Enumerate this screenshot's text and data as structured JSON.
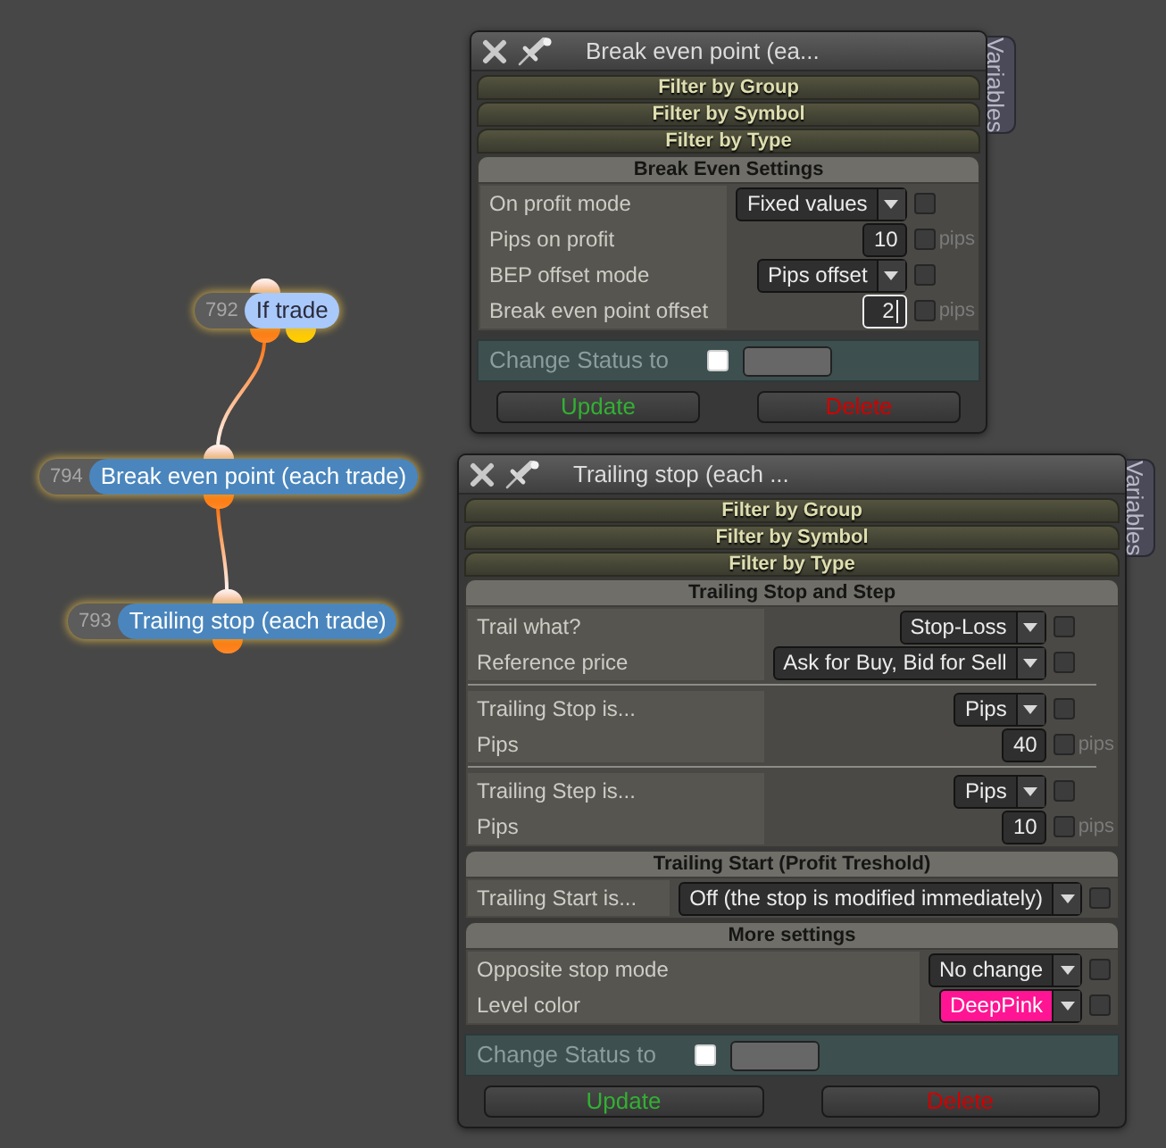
{
  "canvas": {
    "nodes": [
      {
        "number": "792",
        "title": "If trade",
        "kind": "condition"
      },
      {
        "number": "794",
        "title": "Break even point (each trade)",
        "kind": "action"
      },
      {
        "number": "793",
        "title": "Trailing stop (each trade)",
        "kind": "action"
      }
    ]
  },
  "windows": [
    {
      "title": "Break even point (ea...",
      "side_tab": "Variables",
      "filters": [
        "Filter by Group",
        "Filter by Symbol",
        "Filter by Type"
      ],
      "sections": [
        {
          "title": "Break Even Settings",
          "groups": [
            {
              "rows": [
                {
                  "kind": "dropdown",
                  "label": "On profit mode",
                  "value": "Fixed values",
                  "checked": false
                },
                {
                  "kind": "number",
                  "label": "Pips on profit",
                  "value": "10",
                  "unit": "pips",
                  "checked": false,
                  "focused": false
                },
                {
                  "kind": "dropdown",
                  "label": "BEP offset mode",
                  "value": "Pips offset",
                  "checked": false
                },
                {
                  "kind": "number",
                  "label": "Break even point offset",
                  "value": "2",
                  "unit": "pips",
                  "checked": false,
                  "focused": true
                }
              ]
            }
          ]
        }
      ],
      "change_status": {
        "label": "Change Status to",
        "checked": false
      },
      "buttons": [
        {
          "label": "Update",
          "kind": "update"
        },
        {
          "label": "Delete",
          "kind": "delete"
        }
      ]
    },
    {
      "title": "Trailing stop (each ...",
      "side_tab": "Variables",
      "filters": [
        "Filter by Group",
        "Filter by Symbol",
        "Filter by Type"
      ],
      "sections": [
        {
          "title": "Trailing Stop and Step",
          "groups": [
            {
              "rows": [
                {
                  "kind": "dropdown",
                  "label": "Trail what?",
                  "value": "Stop-Loss",
                  "checked": false
                },
                {
                  "kind": "dropdown",
                  "label": "Reference price",
                  "value": "Ask for Buy, Bid for Sell",
                  "checked": false
                }
              ]
            },
            {
              "rows": [
                {
                  "kind": "dropdown",
                  "label": "Trailing Stop is...",
                  "value": "Pips",
                  "checked": false
                },
                {
                  "kind": "number",
                  "label": "Pips",
                  "value": "40",
                  "unit": "pips",
                  "checked": false,
                  "focused": false
                }
              ]
            },
            {
              "rows": [
                {
                  "kind": "dropdown",
                  "label": "Trailing Step is...",
                  "value": "Pips",
                  "checked": false
                },
                {
                  "kind": "number",
                  "label": "Pips",
                  "value": "10",
                  "unit": "pips",
                  "checked": false,
                  "focused": false
                }
              ]
            }
          ]
        },
        {
          "title": "Trailing Start (Profit Treshold)",
          "groups": [
            {
              "rows": [
                {
                  "kind": "dropdown",
                  "label": "Trailing Start is...",
                  "value": "Off (the stop is modified immediately)",
                  "checked": false
                }
              ]
            }
          ]
        },
        {
          "title": "More settings",
          "groups": [
            {
              "rows": [
                {
                  "kind": "dropdown",
                  "label": "Opposite stop mode",
                  "value": "No change",
                  "checked": false
                },
                {
                  "kind": "dropdown",
                  "label": "Level color",
                  "value": "DeepPink",
                  "color": "#ff1493",
                  "checked": false
                }
              ]
            }
          ]
        }
      ],
      "change_status": {
        "label": "Change Status to",
        "checked": false
      },
      "buttons": [
        {
          "label": "Update",
          "kind": "update"
        },
        {
          "label": "Delete",
          "kind": "delete"
        }
      ]
    }
  ]
}
